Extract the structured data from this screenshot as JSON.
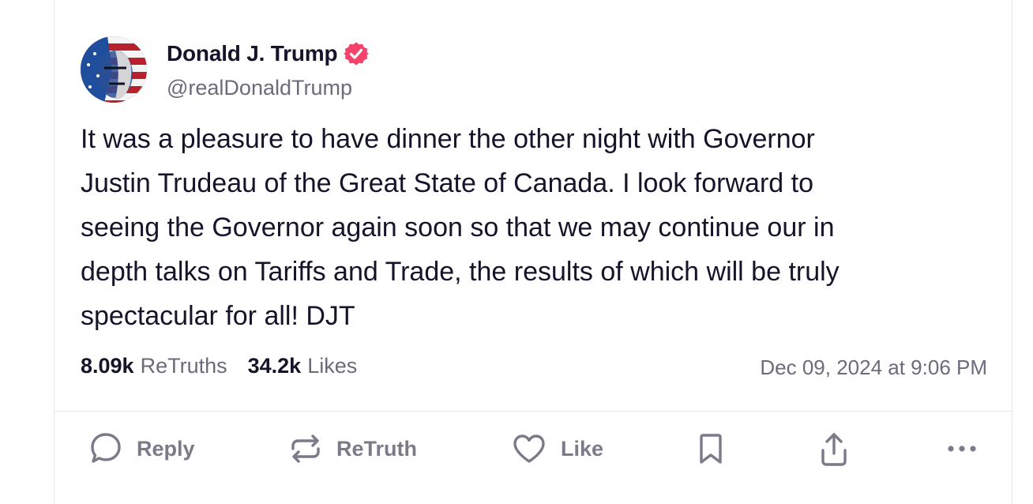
{
  "post": {
    "author_name": "Donald J. Trump",
    "author_handle": "@realDonaldTrump",
    "verified_icon": "verified-badge-icon",
    "text": "It was a pleasure to have dinner the other night with Governor\nJustin Trudeau of the Great State of Canada. I look forward to\nseeing the Governor again soon so that we may continue our in\ndepth talks on Tariffs and Trade, the results of which will be truly\nspectacular for all! DJT",
    "retruths_count": "8.09k",
    "retruths_label": "ReTruths",
    "likes_count": "34.2k",
    "likes_label": "Likes",
    "timestamp": "Dec 09, 2024 at 9:06 PM"
  },
  "actions": {
    "reply_label": "Reply",
    "retruth_label": "ReTruth",
    "like_label": "Like"
  },
  "colors": {
    "verified": "#f5436b",
    "text": "#14142a",
    "muted": "#6b6b7b",
    "action": "#7a7a88"
  }
}
